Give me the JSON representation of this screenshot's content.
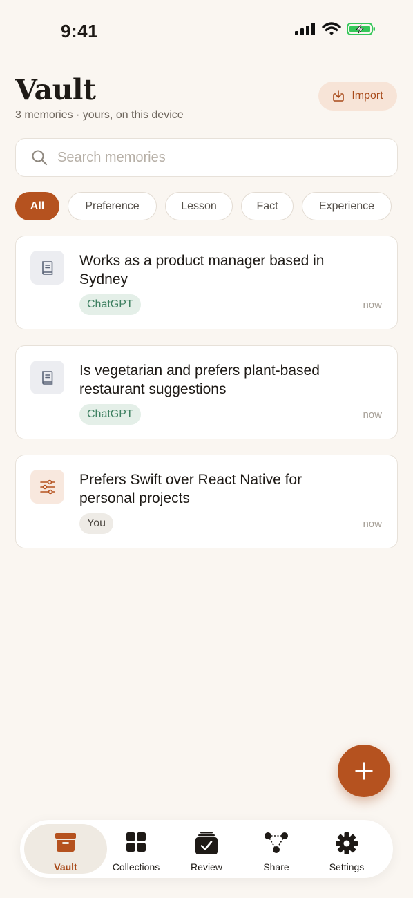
{
  "status": {
    "time": "9:41"
  },
  "header": {
    "title": "Vault",
    "subtitle": "3 memories · yours, on this device",
    "import_label": "Import"
  },
  "search": {
    "placeholder": "Search memories",
    "value": ""
  },
  "filters": [
    {
      "label": "All",
      "active": true
    },
    {
      "label": "Preference",
      "active": false
    },
    {
      "label": "Lesson",
      "active": false
    },
    {
      "label": "Fact",
      "active": false
    },
    {
      "label": "Experience",
      "active": false
    }
  ],
  "memories": [
    {
      "text": "Works as a product manager based in Sydney",
      "source": "ChatGPT",
      "time": "now",
      "icon": "book-icon"
    },
    {
      "text": "Is vegetarian and prefers plant-based restaurant suggestions",
      "source": "ChatGPT",
      "time": "now",
      "icon": "book-icon"
    },
    {
      "text": "Prefers Swift over React Native for personal projects",
      "source": "You",
      "time": "now",
      "icon": "sliders-icon"
    }
  ],
  "tabs": [
    {
      "label": "Vault",
      "icon": "archive-box-icon",
      "active": true
    },
    {
      "label": "Collections",
      "icon": "grid-icon",
      "active": false
    },
    {
      "label": "Review",
      "icon": "checklist-stack-icon",
      "active": false
    },
    {
      "label": "Share",
      "icon": "share-nodes-icon",
      "active": false
    },
    {
      "label": "Settings",
      "icon": "gear-icon",
      "active": false
    }
  ],
  "colors": {
    "background": "#FAF6F1",
    "accent": "#B5521F",
    "source_chatgpt_bg": "#E4EFE8",
    "source_chatgpt_fg": "#3E8061"
  }
}
